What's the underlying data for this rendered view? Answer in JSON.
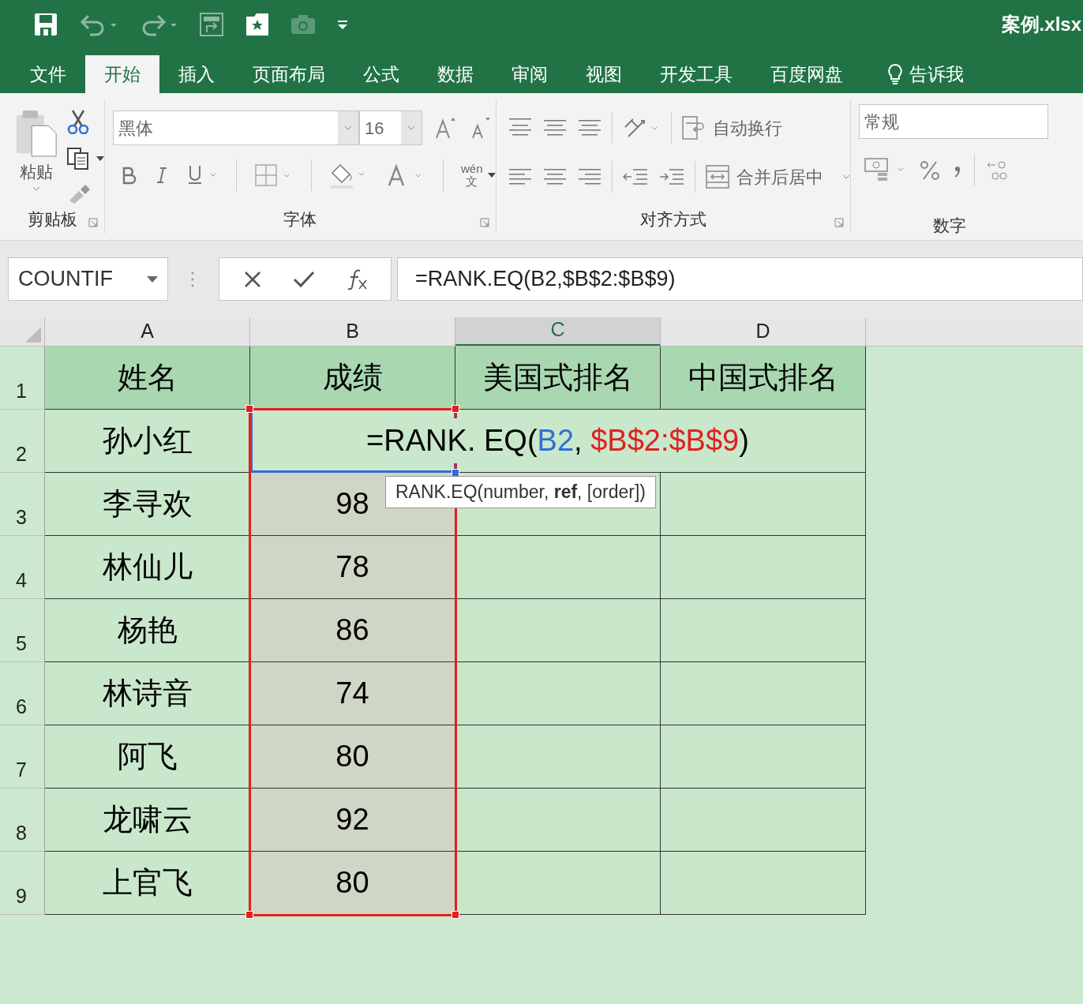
{
  "window": {
    "title": "案例.xlsx"
  },
  "tabs": [
    {
      "label": "文件",
      "selected": false
    },
    {
      "label": "开始",
      "selected": true
    },
    {
      "label": "插入",
      "selected": false
    },
    {
      "label": "页面布局",
      "selected": false
    },
    {
      "label": "公式",
      "selected": false
    },
    {
      "label": "数据",
      "selected": false
    },
    {
      "label": "审阅",
      "selected": false
    },
    {
      "label": "视图",
      "selected": false
    },
    {
      "label": "开发工具",
      "selected": false
    },
    {
      "label": "百度网盘",
      "selected": false
    }
  ],
  "tell_me": "告诉我",
  "ribbon": {
    "paste_label": "粘贴",
    "clipboard_group": "剪贴板",
    "font_name": "黑体",
    "font_size": "16",
    "font_group": "字体",
    "wrap_text": "自动换行",
    "merge_center": "合并后居中",
    "alignment_group": "对齐方式",
    "number_format": "常规",
    "number_group": "数字",
    "pinyin_top": "wén",
    "pinyin_bottom": "文"
  },
  "formula_bar": {
    "name_box": "COUNTIF",
    "formula": "=RANK.EQ(B2,$B$2:$B$9)"
  },
  "sheet": {
    "columns": [
      {
        "label": "A",
        "selected": false
      },
      {
        "label": "B",
        "selected": false
      },
      {
        "label": "C",
        "selected": true
      },
      {
        "label": "D",
        "selected": false
      }
    ],
    "rows": [
      {
        "number": "1",
        "kind": "header",
        "cells": [
          "姓名",
          "成绩",
          "美国式排名",
          "中国式排名"
        ]
      },
      {
        "number": "2",
        "kind": "editing",
        "cells": [
          "孙小红"
        ],
        "edit_parts": [
          {
            "text": "=RANK. EQ(",
            "color": "#000000"
          },
          {
            "text": "B2",
            "color": "#2f6fd6"
          },
          {
            "text": ", ",
            "color": "#000000"
          },
          {
            "text": "$B$2:$B$9",
            "color": "#e02020"
          },
          {
            "text": ")",
            "color": "#000000"
          }
        ],
        "tooltip": "RANK.EQ(number, **ref**, [order])"
      },
      {
        "number": "3",
        "kind": "data",
        "cells": [
          "李寻欢",
          "98"
        ]
      },
      {
        "number": "4",
        "kind": "data",
        "cells": [
          "林仙儿",
          "78"
        ]
      },
      {
        "number": "5",
        "kind": "data",
        "cells": [
          "杨艳",
          "86"
        ]
      },
      {
        "number": "6",
        "kind": "data",
        "cells": [
          "林诗音",
          "74"
        ]
      },
      {
        "number": "7",
        "kind": "data",
        "cells": [
          "阿飞",
          "80"
        ]
      },
      {
        "number": "8",
        "kind": "data",
        "cells": [
          "龙啸云",
          "92"
        ]
      },
      {
        "number": "9",
        "kind": "data",
        "cells": [
          "上官飞",
          "80"
        ]
      }
    ]
  }
}
